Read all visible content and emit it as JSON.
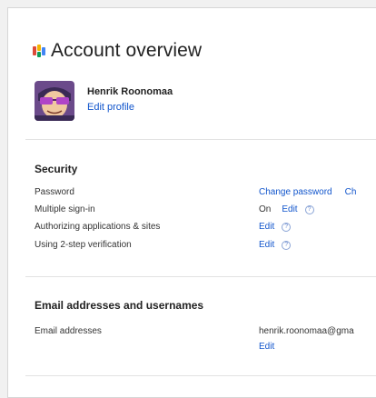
{
  "header": {
    "title": "Account overview"
  },
  "profile": {
    "name": "Henrik Roonomaa",
    "edit_label": "Edit profile"
  },
  "security": {
    "title": "Security",
    "password": {
      "label": "Password",
      "change": "Change password",
      "extra": "Ch"
    },
    "multiple_signin": {
      "label": "Multiple sign-in",
      "status": "On",
      "edit": "Edit"
    },
    "authorizing": {
      "label": "Authorizing applications & sites",
      "edit": "Edit"
    },
    "two_step": {
      "label": "Using 2-step verification",
      "edit": "Edit"
    }
  },
  "emails": {
    "title": "Email addresses and usernames",
    "label": "Email addresses",
    "value": "henrik.roonomaa@gma",
    "edit": "Edit"
  },
  "colors": {
    "link": "#1155cc",
    "background": "#f1f1f1",
    "card": "#ffffff"
  }
}
